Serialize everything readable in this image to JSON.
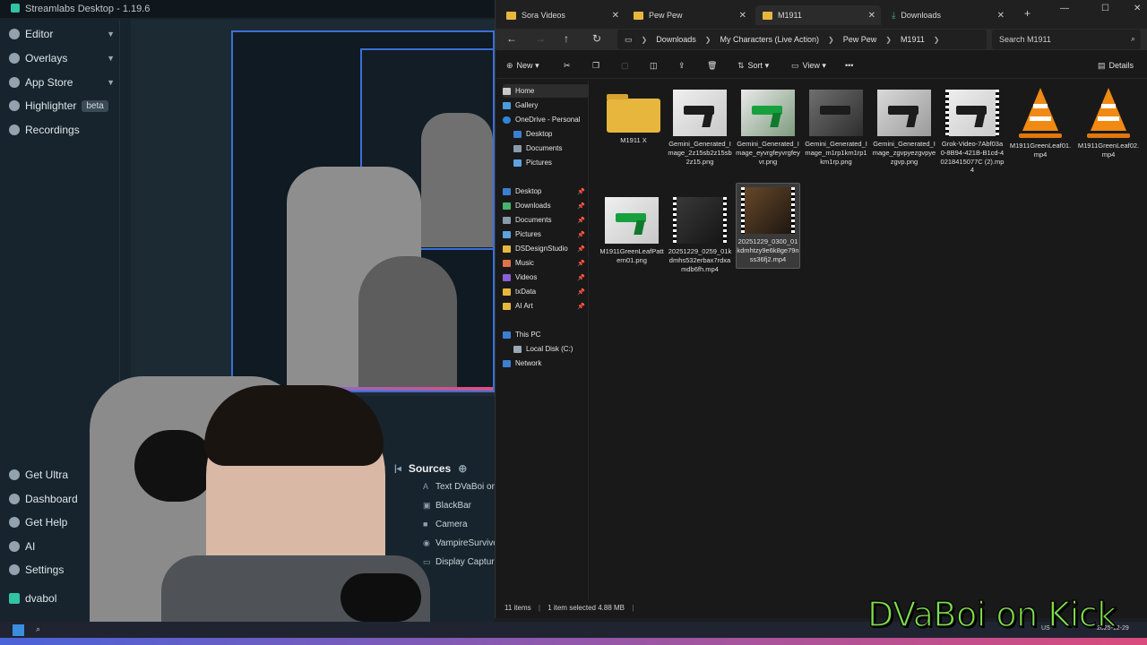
{
  "streamlabs": {
    "title": "Streamlabs Desktop - 1.19.6",
    "nav": [
      {
        "label": "Editor"
      },
      {
        "label": "Overlays"
      },
      {
        "label": "App Store"
      },
      {
        "label": "Highlighter",
        "badge": "beta"
      },
      {
        "label": "Recordings"
      }
    ],
    "bottom_nav": [
      {
        "label": "Get Ultra"
      },
      {
        "label": "Dashboard"
      },
      {
        "label": "Get Help"
      },
      {
        "label": "AI"
      },
      {
        "label": "Settings"
      },
      {
        "label": "dvabol"
      }
    ],
    "sources": {
      "title": "Sources",
      "items": [
        "Text DVaBoi on",
        "BlackBar",
        "Camera",
        "VampireSurvivo",
        "Display Capture"
      ]
    }
  },
  "explorer": {
    "tabs": [
      {
        "label": "Sora Videos"
      },
      {
        "label": "Pew Pew"
      },
      {
        "label": "M1911"
      },
      {
        "label": "Downloads"
      }
    ],
    "breadcrumb": [
      "Downloads",
      "My Characters (Live Action)",
      "Pew Pew",
      "M1911"
    ],
    "search_placeholder": "Search M1911",
    "toolbar": {
      "new": "New",
      "sort": "Sort",
      "view": "View",
      "more": "•••",
      "details": "Details"
    },
    "nav": {
      "home": "Home",
      "gallery": "Gallery",
      "onedrive": "OneDrive - Personal",
      "od_desktop": "Desktop",
      "od_documents": "Documents",
      "od_pictures": "Pictures",
      "quick": [
        "Desktop",
        "Downloads",
        "Documents",
        "Pictures",
        "DSDesignStudio",
        "Music",
        "Videos",
        "txData",
        "AI Art"
      ],
      "thispc": "This PC",
      "localdisk": "Local Disk (C:)",
      "network": "Network"
    },
    "files": [
      {
        "name": "M1911 X",
        "kind": "folder"
      },
      {
        "name": "Gemini_Generated_Image_2z15sb2z15sb2z15.png",
        "kind": "img-gray"
      },
      {
        "name": "Gemini_Generated_Image_eyvrgfeyvrgfeyvr.png",
        "kind": "img-green"
      },
      {
        "name": "Gemini_Generated_Image_m1rp1km1rp1km1rp.png",
        "kind": "img-case"
      },
      {
        "name": "Gemini_Generated_Image_zgvpyezgvpyezgvp.png",
        "kind": "img-gun"
      },
      {
        "name": "Grok-Video-7Abf03a0-8B94-421B-B1cd-40218415077C (2).mp4",
        "kind": "video"
      },
      {
        "name": "M1911GreenLeaf01.mp4",
        "kind": "vlc"
      },
      {
        "name": "M1911GreenLeaf02.mp4",
        "kind": "vlc"
      },
      {
        "name": "M1911GreenLeafPattern01.png",
        "kind": "img-green2"
      },
      {
        "name": "20251229_0259_01kdmhs532erbax7rdxamdb6fh.mp4",
        "kind": "video-dark"
      },
      {
        "name": "20251229_0300_01kdmhtzy9e6k8ge79nss36fj2.mp4",
        "kind": "video-dark",
        "selected": true
      }
    ],
    "status": {
      "count": "11 items",
      "selection": "1 item selected  4.88 MB"
    }
  },
  "taskbar": {
    "lang": "US",
    "date": "2025-12-29"
  },
  "overlay": {
    "text": "DVaBoi on Kick"
  },
  "colors": {
    "accent_green": "#7fe04a",
    "folder_yellow": "#e7b73d",
    "streamlabs_teal": "#31c3a2"
  }
}
